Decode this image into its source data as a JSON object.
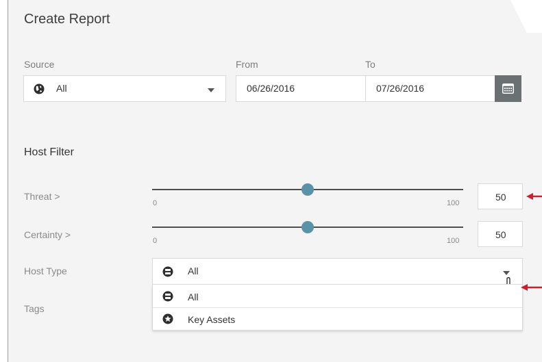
{
  "title": "Create Report",
  "source": {
    "label": "Source",
    "value": "All",
    "icon": "globe-icon"
  },
  "date_range": {
    "from_label": "From",
    "to_label": "To",
    "from_value": "06/26/2016",
    "to_value": "07/26/2016",
    "calendar_icon": "calendar-icon"
  },
  "host_filter": {
    "title": "Host Filter",
    "threat": {
      "label": "Threat >",
      "min_label": "0",
      "max_label": "100",
      "value": "50"
    },
    "certainty": {
      "label": "Certainty >",
      "min_label": "0",
      "max_label": "100",
      "value": "50"
    },
    "host_type": {
      "label": "Host Type",
      "selected": "All",
      "options": [
        {
          "label": "All",
          "icon": "host-icon"
        },
        {
          "label": "Key Assets",
          "icon": "star-badge-icon"
        }
      ]
    },
    "tags": {
      "label": "Tags"
    }
  },
  "colors": {
    "slider_thumb": "#5a93a8",
    "annotation_arrow": "#cc1f2e",
    "calendar_button": "#6b7173"
  }
}
